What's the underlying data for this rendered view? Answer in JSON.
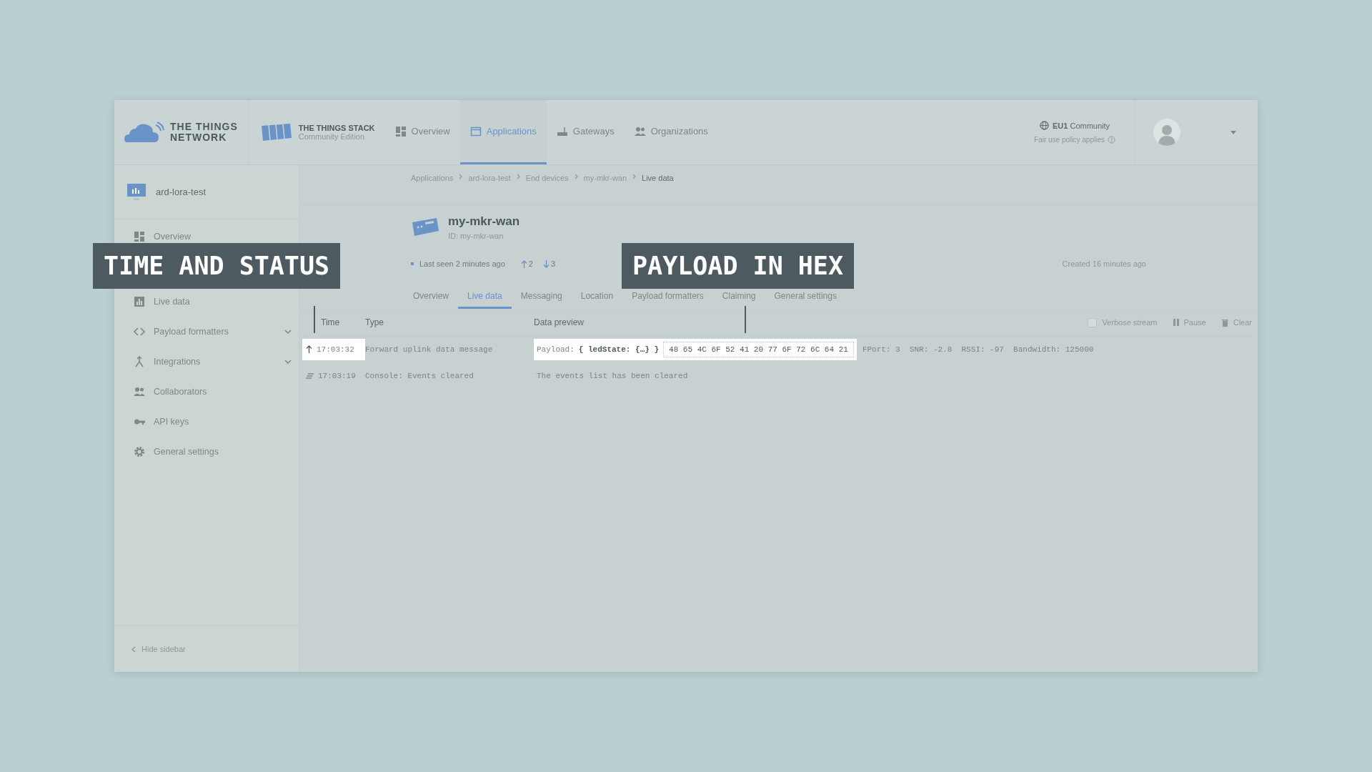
{
  "network_logo": {
    "line_1": "THE THINGS",
    "line_2": "NETWORK"
  },
  "stack_logo": {
    "title": "THE THINGS STACK",
    "subtitle": "Community Edition"
  },
  "nav": [
    {
      "label": "Overview",
      "kind": "overview",
      "selected": false
    },
    {
      "label": "Applications",
      "kind": "applications",
      "selected": true
    },
    {
      "label": "Gateways",
      "kind": "gateways",
      "selected": false
    },
    {
      "label": "Organizations",
      "kind": "organizations",
      "selected": false
    }
  ],
  "cluster": {
    "name": "**EU1** Community",
    "note": "Fair use policy applies"
  },
  "sidebar": {
    "app_name": "ard-lora-test",
    "items": [
      {
        "label": "Overview",
        "kind": "overview",
        "has_submenu": false
      },
      {
        "label": "Live data",
        "kind": "live",
        "has_submenu": false
      },
      {
        "label": "Payload formatters",
        "kind": "code",
        "has_submenu": true
      },
      {
        "label": "Integrations",
        "kind": "integrations",
        "has_submenu": true
      },
      {
        "label": "Collaborators",
        "kind": "people",
        "has_submenu": false
      },
      {
        "label": "API keys",
        "kind": "key",
        "has_submenu": false
      },
      {
        "label": "General settings",
        "kind": "gear",
        "has_submenu": false
      }
    ],
    "hide_label": "Hide sidebar"
  },
  "breadcrumbs": [
    "Applications",
    "ard-lora-test",
    "End devices",
    "my-mkr-wan",
    "Live data"
  ],
  "device": {
    "name": "my-mkr-wan",
    "id": "ID: my-mkr-wan",
    "last_seen": "Last seen 2 minutes ago",
    "uplinks": "2",
    "downlinks": "3",
    "created": "Created 16 minutes ago"
  },
  "tabs": [
    {
      "label": "Overview",
      "selected": false
    },
    {
      "label": "Live data",
      "selected": true
    },
    {
      "label": "Messaging",
      "selected": false
    },
    {
      "label": "Location",
      "selected": false
    },
    {
      "label": "Payload formatters",
      "selected": false
    },
    {
      "label": "Claiming",
      "selected": false
    },
    {
      "label": "General settings",
      "selected": false
    }
  ],
  "stream_controls": {
    "verbose": {
      "label": "Verbose stream",
      "checked": false
    },
    "pause": "Pause",
    "clear": "Clear"
  },
  "table": {
    "columns": [
      "Time",
      "Type",
      "Data preview"
    ],
    "rows": [
      {
        "kind": "uplink",
        "highlighted": true,
        "time": "17:03:32",
        "type": "Forward uplink data message",
        "payload_label": "Payload:",
        "payload_object": "{ ledState: {…} }",
        "payload_hex": "48 65 4C 6F 52 41 20 77 6F 72 6C 64 21",
        "details": "FPort: 3  SNR: -2.8  RSSI: -97  Bandwidth: 125000"
      },
      {
        "kind": "console",
        "highlighted": false,
        "time": "17:03:19",
        "type": "Console: Events cleared",
        "preview": "The events list has been cleared"
      }
    ]
  },
  "callouts": [
    {
      "text": "TIME AND STATUS"
    },
    {
      "text": "PAYLOAD IN HEX"
    }
  ]
}
